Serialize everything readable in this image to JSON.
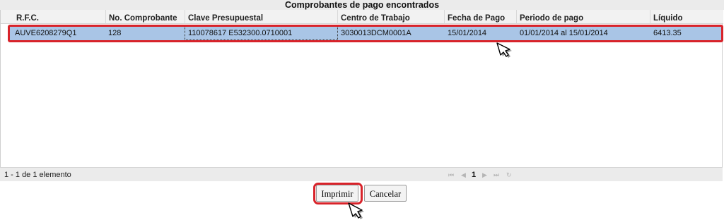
{
  "title": "Comprobantes de pago encontrados",
  "columns": [
    "R.F.C.",
    "No. Comprobante",
    "Clave Presupuestal",
    "Centro de Trabajo",
    "Fecha de Pago",
    "Periodo de pago",
    "Líquido"
  ],
  "rows": [
    {
      "rfc": "AUVE6208279Q1",
      "comprobante": "128",
      "clave": "110078617 E532300.0710001",
      "centro": "3030013DCM0001A",
      "fecha": "15/01/2014",
      "periodo": "01/01/2014 al 15/01/2014",
      "liquido": "6413.35"
    }
  ],
  "footer": {
    "info": "1 - 1 de 1 elemento",
    "current_page": "1"
  },
  "buttons": {
    "print_label": "Imprimir",
    "cancel_label": "Cancelar"
  },
  "colors": {
    "selected_row": "#a9c5e6",
    "highlight": "#d8232a",
    "header_bg": "#f2f2f2"
  },
  "icons": [
    "first-page-icon",
    "prev-page-icon",
    "next-page-icon",
    "last-page-icon",
    "refresh-icon",
    "mouse-pointer-icon"
  ]
}
